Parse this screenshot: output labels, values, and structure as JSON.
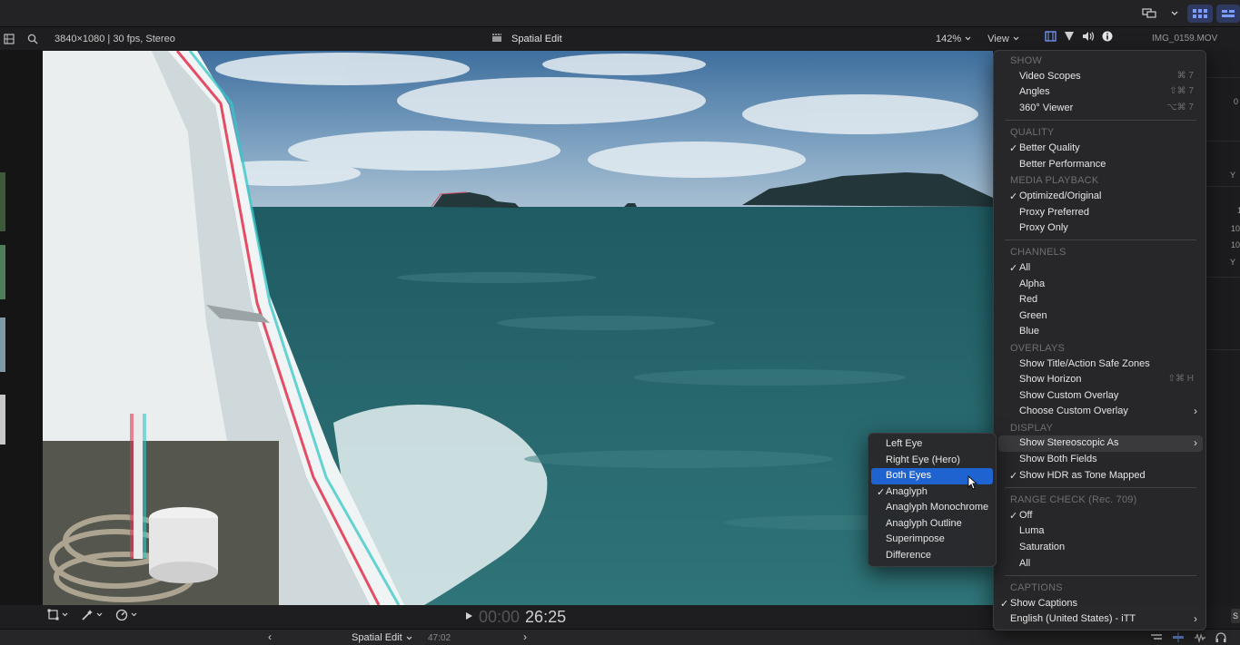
{
  "viewer": {
    "format": "3840×1080 | 30 fps, Stereo",
    "title": "Spatial Edit",
    "zoom": "142%",
    "view_label": "View",
    "filename": "IMG_0159.MOV"
  },
  "timecode": {
    "dim": "00:00",
    "main": "26:25"
  },
  "timeline": {
    "name": "Spatial Edit",
    "duration": "47:02"
  },
  "right_panel": {
    "values": [
      "0",
      "Y",
      "1",
      "10",
      "10",
      "Y"
    ],
    "bottom_badge": "S"
  },
  "menu": {
    "sections": {
      "show": "SHOW",
      "quality": "QUALITY",
      "media_playback": "MEDIA PLAYBACK",
      "channels": "CHANNELS",
      "overlays": "OVERLAYS",
      "display": "DISPLAY",
      "range_check": "RANGE CHECK (Rec. 709)",
      "captions": "CAPTIONS"
    },
    "items": {
      "video_scopes": {
        "label": "Video Scopes",
        "shortcut": "⌘ 7"
      },
      "angles": {
        "label": "Angles",
        "shortcut": "⇧⌘ 7"
      },
      "viewer_360": {
        "label": "360° Viewer",
        "shortcut": "⌥⌘ 7"
      },
      "better_quality": {
        "label": "Better Quality"
      },
      "better_performance": {
        "label": "Better Performance"
      },
      "optimized_original": {
        "label": "Optimized/Original"
      },
      "proxy_preferred": {
        "label": "Proxy Preferred"
      },
      "proxy_only": {
        "label": "Proxy Only"
      },
      "ch_all": {
        "label": "All"
      },
      "ch_alpha": {
        "label": "Alpha"
      },
      "ch_red": {
        "label": "Red"
      },
      "ch_green": {
        "label": "Green"
      },
      "ch_blue": {
        "label": "Blue"
      },
      "safe_zones": {
        "label": "Show Title/Action Safe Zones"
      },
      "horizon": {
        "label": "Show Horizon",
        "shortcut": "⇧⌘ H"
      },
      "custom_overlay": {
        "label": "Show Custom Overlay"
      },
      "choose_overlay": {
        "label": "Choose Custom Overlay"
      },
      "stereoscopic": {
        "label": "Show Stereoscopic As"
      },
      "both_fields": {
        "label": "Show Both Fields"
      },
      "hdr_tone": {
        "label": "Show HDR as Tone Mapped"
      },
      "rc_off": {
        "label": "Off"
      },
      "rc_luma": {
        "label": "Luma"
      },
      "rc_saturation": {
        "label": "Saturation"
      },
      "rc_all": {
        "label": "All"
      },
      "show_captions": {
        "label": "Show Captions"
      },
      "caption_lang": {
        "label": "English (United States) - iTT"
      }
    }
  },
  "submenu": {
    "left_eye": "Left Eye",
    "right_eye": "Right Eye (Hero)",
    "both_eyes": "Both Eyes",
    "anaglyph": "Anaglyph",
    "anaglyph_mono": "Anaglyph Monochrome",
    "anaglyph_outline": "Anaglyph Outline",
    "superimpose": "Superimpose",
    "difference": "Difference"
  },
  "checkmark": "✓",
  "colors": {
    "menu_bg": "#28282a",
    "selection": "#1f63d1",
    "sea": "#2e6e72",
    "sky": "#6a93b8"
  }
}
